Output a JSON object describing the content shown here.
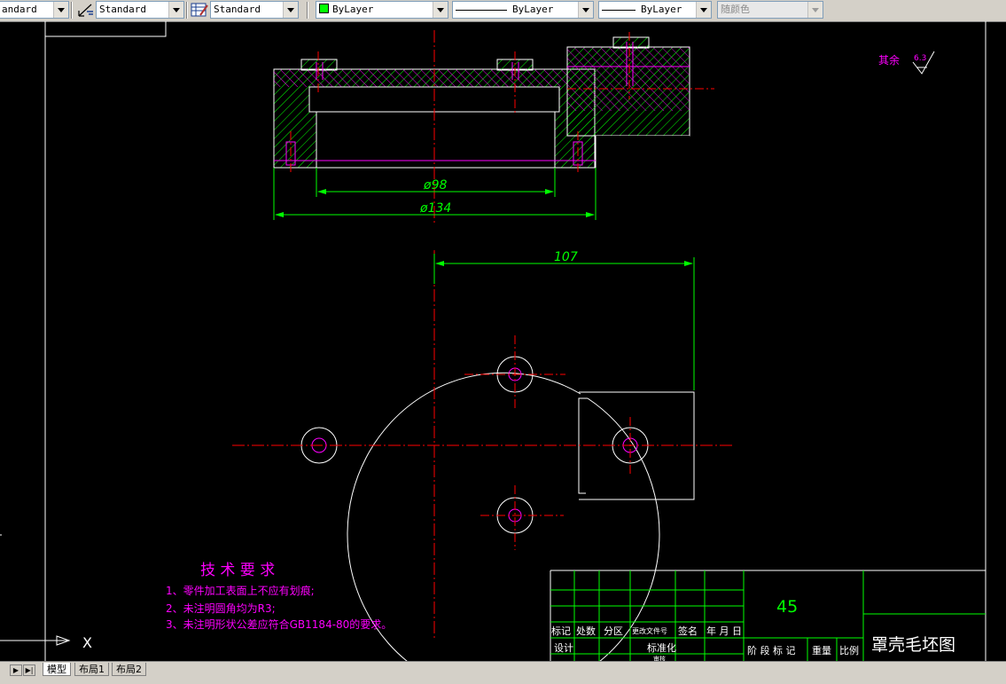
{
  "toolbar": {
    "text_style": "andard",
    "dim_style": "Standard",
    "table_style": "Standard",
    "layer": "ByLayer",
    "linetype": "ByLayer",
    "lineweight": "ByLayer",
    "plot_style": "随颜色",
    "icons": [
      "dimension-style-icon",
      "table-style-icon"
    ]
  },
  "drawing": {
    "dimensions": {
      "d98": "ø98",
      "d134": "ø134",
      "len107": "107"
    },
    "roughness": {
      "label": "其余",
      "value": "6.3"
    },
    "tech_requirements": {
      "title": "技 术 要 求",
      "items": [
        "1、零件加工表面上不应有划痕;",
        "2、未注明圆角均为R3;",
        "3、未注明形状公差应符合GB1184-80的要求。"
      ]
    },
    "ucs": {
      "x_label": "X"
    },
    "title_block": {
      "material": "45",
      "part_name": "罩壳毛坯图",
      "labels": {
        "mark": "标记",
        "count": "处数",
        "zone": "分区",
        "change_doc": "更改文件号",
        "sign": "签名",
        "date": "年 月 日",
        "design": "设计",
        "standardize": "标准化",
        "stage_mark": "阶 段 标 记",
        "weight": "重量",
        "scale": "比例",
        "check": "审核"
      }
    },
    "colors": {
      "outline": "#ffffff",
      "center": "#ff0000",
      "hatch": "#00ff00",
      "hidden": "#ff00ff",
      "dim": "#00ff00",
      "text_magenta": "#ff00ff"
    }
  },
  "tabs": {
    "model": "模型",
    "layout1": "布局1",
    "layout2": "布局2"
  }
}
